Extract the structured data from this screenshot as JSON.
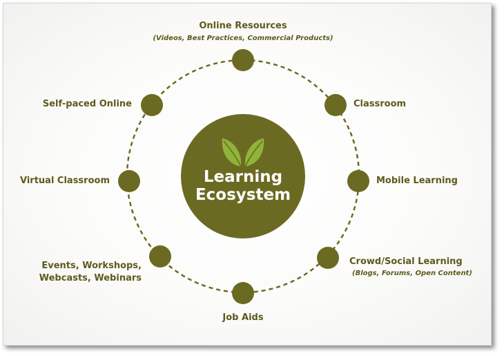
{
  "colors": {
    "accent": "#6b6a22",
    "node": "#6b6a22",
    "text": "#5d5a1c",
    "leaf": "#8fb43a"
  },
  "center": {
    "line1": "Learning",
    "line2": "Ecosystem",
    "icon": "leaf-icon"
  },
  "nodes": {
    "online_resources": {
      "label": "Online Resources",
      "sub": "(Videos, Best Practices, Commercial Products)"
    },
    "classroom": {
      "label": "Classroom"
    },
    "mobile_learning": {
      "label": "Mobile Learning"
    },
    "crowd_social": {
      "label": "Crowd/Social Learning",
      "sub": "(Blogs, Forums, Open Content)"
    },
    "job_aids": {
      "label": "Job Aids"
    },
    "events": {
      "line1": "Events, Workshops,",
      "line2": "Webcasts, Webinars"
    },
    "virtual_classroom": {
      "label": "Virtual Classroom"
    },
    "self_paced": {
      "label": "Self-paced Online"
    }
  }
}
